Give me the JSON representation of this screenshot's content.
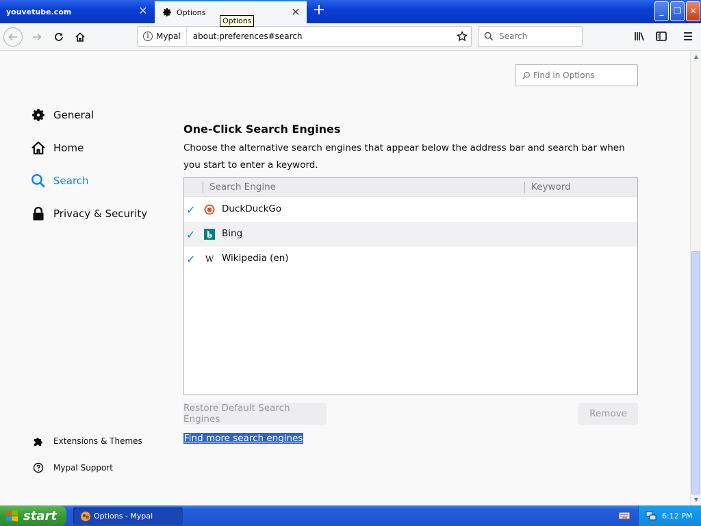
{
  "tabs": {
    "background": {
      "title": "youvetube.com"
    },
    "active": {
      "title": "Options"
    },
    "tooltip": "Options"
  },
  "navbar": {
    "identity_label": "Mypal",
    "url": "about:preferences#search",
    "search_placeholder": "Search"
  },
  "find_options": {
    "placeholder": "Find in Options"
  },
  "categories": [
    {
      "label": "General",
      "icon": "gear-icon"
    },
    {
      "label": "Home",
      "icon": "home-icon"
    },
    {
      "label": "Search",
      "icon": "search-icon",
      "selected": true
    },
    {
      "label": "Privacy & Security",
      "icon": "lock-icon"
    }
  ],
  "footer_links": [
    {
      "label": "Extensions & Themes",
      "icon": "puzzle-icon"
    },
    {
      "label": "Mypal Support",
      "icon": "help-icon"
    }
  ],
  "section": {
    "title": "One-Click Search Engines",
    "description": "Choose the alternative search engines that appear below the address bar and search bar when you start to enter a keyword."
  },
  "engines_table": {
    "columns": [
      "Search Engine",
      "Keyword"
    ],
    "rows": [
      {
        "name": "DuckDuckGo",
        "checked": true,
        "keyword": "",
        "icon": "duckduckgo-icon"
      },
      {
        "name": "Bing",
        "checked": true,
        "keyword": "",
        "icon": "bing-icon"
      },
      {
        "name": "Wikipedia (en)",
        "checked": true,
        "keyword": "",
        "icon": "wikipedia-icon"
      }
    ]
  },
  "buttons": {
    "restore": "Restore Default Search Engines",
    "remove": "Remove"
  },
  "find_more_link": "Find more search engines",
  "taskbar": {
    "start_label": "start",
    "task_item": "Options - Mypal",
    "clock": "6:12 PM"
  },
  "colors": {
    "accent": "#0a84ff",
    "xp_taskbar": "#245ddb",
    "selection": "#3163c5"
  }
}
